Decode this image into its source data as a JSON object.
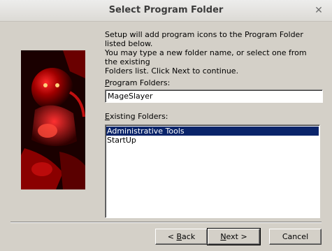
{
  "window": {
    "title": "Select Program Folder",
    "close_glyph": "✕"
  },
  "instructions": "Setup will add program icons to the Program Folder listed below.\nYou may type a new folder name, or select one from the existing\nFolders list.  Click Next to continue.",
  "program_folders": {
    "label_accel": "P",
    "label_rest": "rogram Folders:",
    "value": "MageSlayer"
  },
  "existing_folders": {
    "label_accel": "E",
    "label_rest": "xisting Folders:",
    "items": [
      "Administrative Tools",
      "StartUp"
    ],
    "selected_index": 0
  },
  "buttons": {
    "back_prefix": "< ",
    "back_accel": "B",
    "back_rest": "ack",
    "next_accel": "N",
    "next_rest": "ext >",
    "cancel": "Cancel"
  },
  "colors": {
    "selection": "#0a246a",
    "dialog": "#d4d0c8",
    "art_glow": "#ff1a1a"
  }
}
